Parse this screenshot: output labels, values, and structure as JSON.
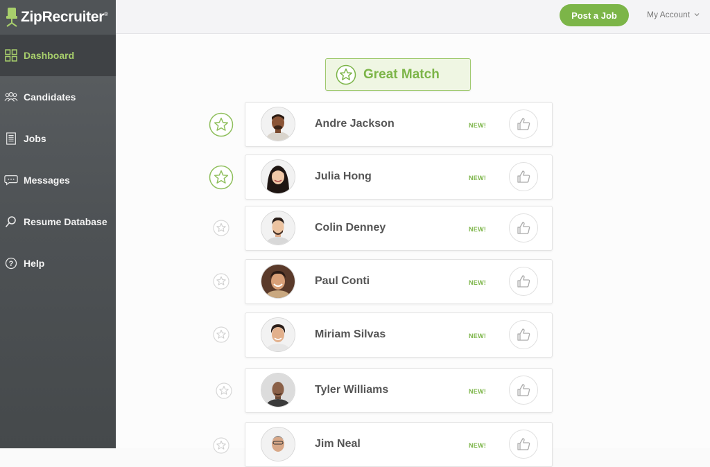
{
  "brand": {
    "name": "ZipRecruiter",
    "trademark": "®",
    "accent": "#7cb548"
  },
  "sidebar": {
    "items": [
      {
        "label": "Dashboard",
        "icon": "dashboard-grid-icon",
        "active": true
      },
      {
        "label": "Candidates",
        "icon": "candidates-people-icon",
        "active": false
      },
      {
        "label": "Jobs",
        "icon": "jobs-document-icon",
        "active": false
      },
      {
        "label": "Messages",
        "icon": "messages-bubble-icon",
        "active": false
      },
      {
        "label": "Resume Database",
        "icon": "search-icon",
        "active": false
      },
      {
        "label": "Help",
        "icon": "help-circle-icon",
        "active": false
      }
    ]
  },
  "header": {
    "post_job_label": "Post a Job",
    "account_label": "My Account"
  },
  "main": {
    "great_match_label": "Great Match",
    "candidates": [
      {
        "name": "Andre Jackson",
        "badge": "NEW!",
        "starred": true
      },
      {
        "name": "Julia Hong",
        "badge": "NEW!",
        "starred": true
      },
      {
        "name": "Colin Denney",
        "badge": "NEW!",
        "starred": false
      },
      {
        "name": "Paul Conti",
        "badge": "NEW!",
        "starred": false
      },
      {
        "name": "Miriam Silvas",
        "badge": "NEW!",
        "starred": false
      },
      {
        "name": "Tyler Williams",
        "badge": "NEW!",
        "starred": false
      },
      {
        "name": "Jim Neal",
        "badge": "NEW!",
        "starred": false
      }
    ]
  }
}
